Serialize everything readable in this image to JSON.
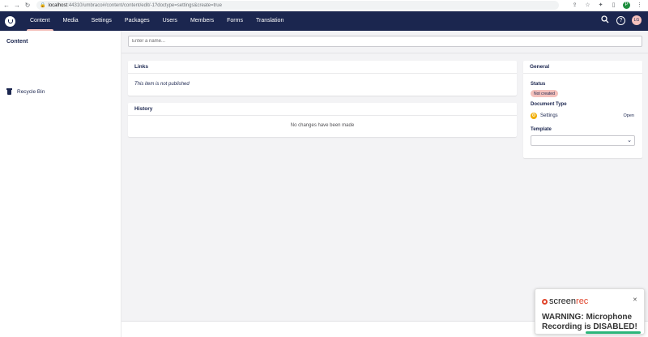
{
  "browser": {
    "back_icon": "arrow-left",
    "forward_icon": "arrow-right",
    "reload_icon": "reload",
    "url_host": "localhost",
    "url_rest": ":44310/umbraco#/content/content/edit/-1?doctype=settings&create=true",
    "profile_initial": "P"
  },
  "header": {
    "sections": [
      "Content",
      "Media",
      "Settings",
      "Packages",
      "Users",
      "Members",
      "Forms",
      "Translation"
    ],
    "active_section": "Content",
    "user_initials": "LG",
    "help_label": "?"
  },
  "tree": {
    "title": "Content",
    "items": [
      {
        "label": "Recycle Bin",
        "icon": "trash-icon"
      }
    ]
  },
  "editor": {
    "name_placeholder": "Enter a name...",
    "links": {
      "title": "Links",
      "message": "This item is not published"
    },
    "history": {
      "title": "History",
      "message": "No changes have been made"
    },
    "general": {
      "title": "General",
      "status_label": "Status",
      "status_value": "Not created",
      "doctype_label": "Document Type",
      "doctype_value": "Settings",
      "open_label": "Open",
      "template_label": "Template",
      "template_value": ""
    }
  },
  "overlay": {
    "brand_a": "screen",
    "brand_b": "rec",
    "warning": "WARNING: Microphone Recording is DISABLED!"
  },
  "colors": {
    "header_bg": "#1b264f",
    "accent_pink": "#f5c1bc",
    "gear_orange": "#f0ac00"
  }
}
